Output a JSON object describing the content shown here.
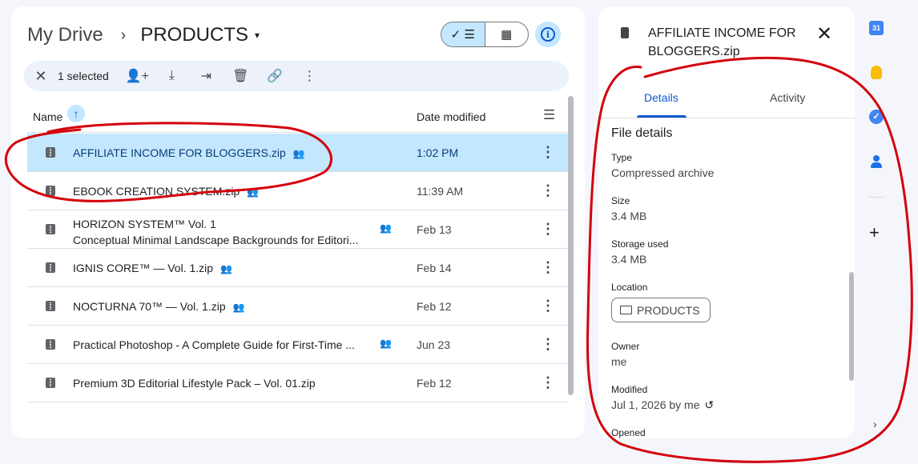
{
  "breadcrumb": {
    "root": "My Drive",
    "separator": "›",
    "current": "PRODUCTS",
    "dropdown": "▾"
  },
  "view_toggle": {
    "list_label": "✓ ☰",
    "grid_label": "▦"
  },
  "info_button": {
    "label": "i"
  },
  "selection_bar": {
    "close": "✕",
    "count_text": "1 selected",
    "actions": [
      {
        "name": "share-icon",
        "glyph": "👤+"
      },
      {
        "name": "download-icon",
        "glyph": "⤓"
      },
      {
        "name": "move-icon",
        "glyph": "⇥"
      },
      {
        "name": "trash-icon",
        "glyph": "🗑"
      },
      {
        "name": "link-icon",
        "glyph": "🔗"
      },
      {
        "name": "more-icon",
        "glyph": "⋮"
      }
    ]
  },
  "table": {
    "col_name": "Name",
    "sort_arrow": "↑",
    "col_date": "Date modified",
    "sort_icon": "☰",
    "rows": [
      {
        "name": "AFFILIATE INCOME FOR BLOGGERS.zip",
        "date": "1:02 PM",
        "shared": true,
        "selected": true
      },
      {
        "name": "EBOOK CREATION SYSTEM.zip",
        "date": "11:39 AM",
        "shared": true
      },
      {
        "line1": "HORIZON SYSTEM™ Vol. 1",
        "line2": "Conceptual Minimal Landscape Backgrounds for Editori...",
        "date": "Feb 13",
        "shared": true
      },
      {
        "name": "IGNIS CORE™ — Vol. 1.zip",
        "date": "Feb 14",
        "shared": true
      },
      {
        "name": "NOCTURNA 70™ — Vol. 1.zip",
        "date": "Feb 12",
        "shared": true
      },
      {
        "name": "Practical Photoshop - A Complete Guide for First-Time ...",
        "date": "Jun 23",
        "shared": true
      },
      {
        "name": "Premium 3D Editorial Lifestyle Pack – Vol. 01.zip",
        "date": "Feb 12",
        "shared": false
      }
    ],
    "more_glyph": "⋮",
    "share_glyph": "👥"
  },
  "details": {
    "title": "AFFILIATE INCOME FOR BLOGGERS.zip",
    "close": "✕",
    "tabs": [
      "Details",
      "Activity"
    ],
    "section_title": "File details",
    "type_label": "Type",
    "type_value": "Compressed archive",
    "size_label": "Size",
    "size_value": "3.4 MB",
    "storage_label": "Storage used",
    "storage_value": "3.4 MB",
    "location_label": "Location",
    "location_value": "PRODUCTS",
    "owner_label": "Owner",
    "owner_value": "me",
    "modified_label": "Modified",
    "modified_value": "Jul 1, 2026 by me",
    "history_glyph": "↺",
    "opened_label": "Opened"
  },
  "rail": {
    "calendar_day": "31",
    "tasks_glyph": "✓",
    "add_glyph": "+",
    "expand_glyph": "›"
  },
  "colors": {
    "accent": "#0b57d0",
    "selected_bg": "#c2e7ff",
    "annotation": "#d4000c"
  }
}
